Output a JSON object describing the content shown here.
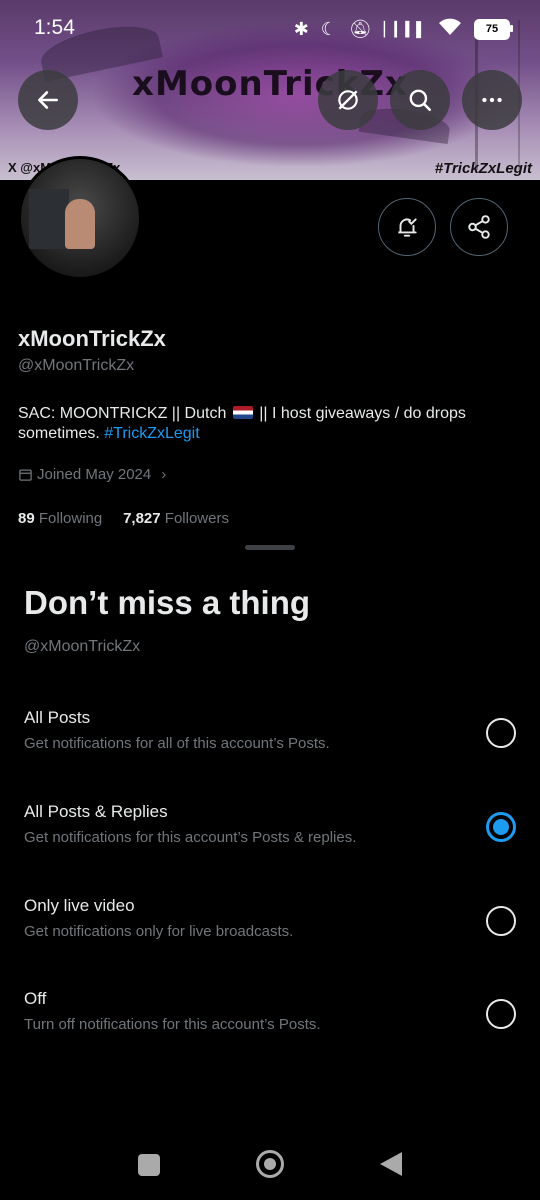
{
  "status_bar": {
    "time": "1:54",
    "battery": "75"
  },
  "banner": {
    "title": "xMoonTrickZx",
    "tag_left": "X @xMoonTrickZx",
    "tag_right": "#TrickZxLegit"
  },
  "profile": {
    "name": "xMoonTrickZx",
    "handle": "@xMoonTrickZx",
    "bio_before_flag": "SAC: MOONTRICKZ || Dutch",
    "bio_after_flag": " || I host giveaways / do drops sometimes. ",
    "bio_hashtag": "#TrickZxLegit",
    "joined": "Joined May 2024",
    "following_count": "89",
    "following_label": "Following",
    "followers_count": "7,827",
    "followers_label": "Followers"
  },
  "sheet": {
    "title": "Don’t miss a thing",
    "handle": "@xMoonTrickZx",
    "options": [
      {
        "label": "All Posts",
        "desc": "Get notifications for all of this account’s Posts.",
        "selected": false
      },
      {
        "label": "All Posts & Replies",
        "desc": "Get notifications for this account’s Posts & replies.",
        "selected": true
      },
      {
        "label": "Only live video",
        "desc": "Get notifications only for live broadcasts.",
        "selected": false
      },
      {
        "label": "Off",
        "desc": "Turn off notifications for this account’s Posts.",
        "selected": false
      }
    ]
  },
  "colors": {
    "accent": "#1d9bf0",
    "secondary_text": "#71767b",
    "background": "#000000"
  }
}
